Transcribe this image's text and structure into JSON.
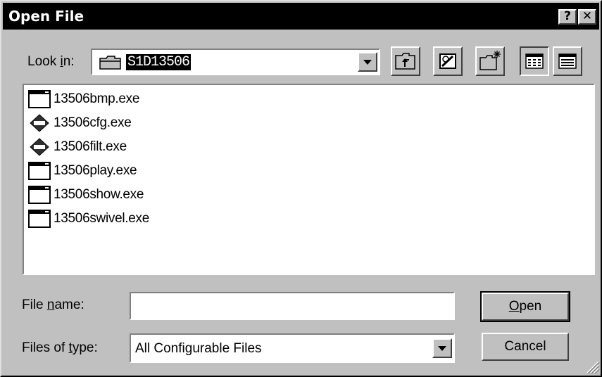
{
  "window": {
    "title": "Open File",
    "help_glyph": "?",
    "close_glyph": "✕"
  },
  "look_in": {
    "label_pre": "Look ",
    "label_accel": "i",
    "label_post": "n:",
    "value": "S1D13506"
  },
  "files": [
    {
      "name": "13506bmp.exe",
      "icon": "window-app-icon"
    },
    {
      "name": "13506cfg.exe",
      "icon": "s1d-diamond-icon"
    },
    {
      "name": "13506filt.exe",
      "icon": "s1d-diamond-icon"
    },
    {
      "name": "13506play.exe",
      "icon": "window-app-icon"
    },
    {
      "name": "13506show.exe",
      "icon": "window-app-icon"
    },
    {
      "name": "13506swivel.exe",
      "icon": "window-app-icon"
    }
  ],
  "file_name": {
    "label_pre": "File ",
    "label_accel": "n",
    "label_post": "ame:",
    "value": ""
  },
  "file_type": {
    "label_pre": "Files of ",
    "label_accel": "t",
    "label_post": "ype:",
    "value": "All Configurable Files"
  },
  "buttons": {
    "open_accel": "O",
    "open_rest": "pen",
    "cancel": "Cancel"
  }
}
